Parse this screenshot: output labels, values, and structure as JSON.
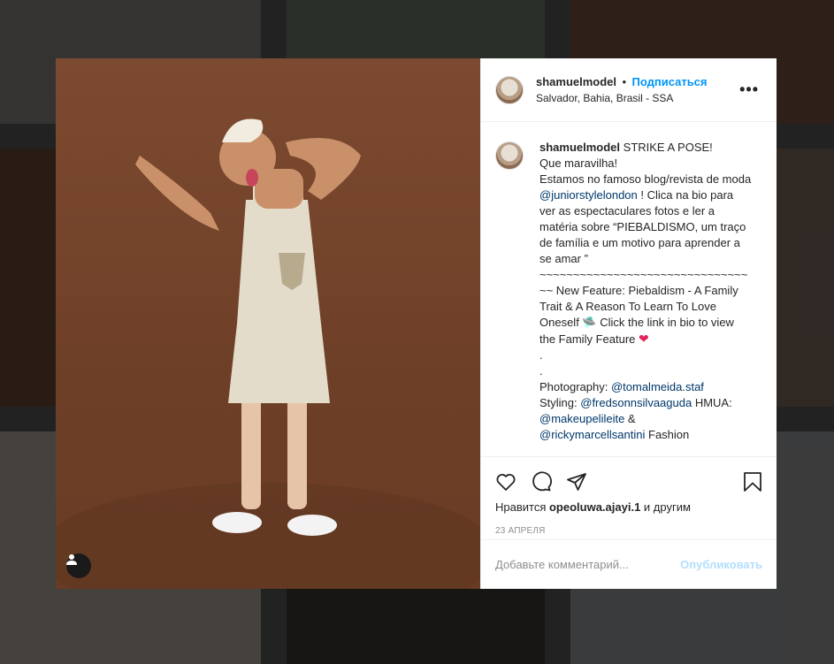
{
  "post": {
    "username": "shamuelmodel",
    "separator": "•",
    "follow_label": "Подписаться",
    "location": "Salvador, Bahia, Brasil - SSA",
    "more_label": "•••"
  },
  "caption": {
    "username": "shamuelmodel",
    "line1": " STRIKE A POSE!\nQue maravilha!\nEstamos no famoso blog/revista de moda ",
    "mention1": "@juniorstylelondon",
    "line2": " ! Clica na bio para ver as espectaculares fotos e ler a matéria sobre “PIEBALDISMO, um traço de família e um motivo para aprender a se amar ”\n~~~~~~~~~~~~~~~~~~~~~~~~~~~~~~~~~ New Feature: Piebaldism - A Family Trait & A Reason To Learn To Love Oneself 🛸 Click the link in bio to view the Family Feature ",
    "heart": "❤",
    "line3": "\n.\n.\nPhotography: ",
    "mention2": "@tomalmeida.staf",
    "line4": "\nStyling: ",
    "mention3": "@fredsonnsilvaaguda",
    "line5": " HMUA: ",
    "mention4": "@makeupelileite",
    "line6": " &\n",
    "mention5": "@rickymarcellsantini",
    "line7": " Fashion"
  },
  "likes": {
    "prefix": "Нравится ",
    "user": "opeoluwa.ajayi.1",
    "suffix": " и другим"
  },
  "date": "23 апреля",
  "comment": {
    "placeholder": "Добавьте комментарий...",
    "post_label": "Опубликовать"
  },
  "icons": [
    "heart-icon",
    "comment-icon",
    "share-icon",
    "bookmark-icon",
    "user-tag-icon"
  ],
  "colors": {
    "accent": "#0095f6",
    "post_disabled": "#b2dffc",
    "mention": "#00376b",
    "photo_bg": "#6e3f27"
  }
}
